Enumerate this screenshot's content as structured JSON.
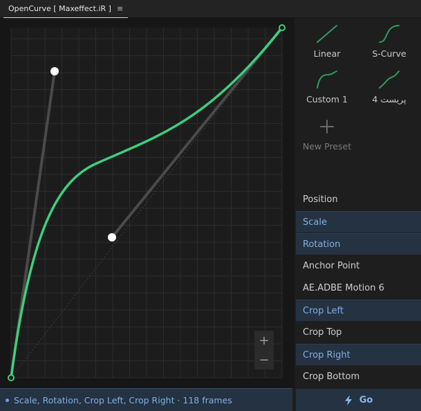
{
  "title_bar": {
    "tab_label": "OpenCurve [ Maxeffect.iR ]",
    "menu_glyph": "≡",
    "menu_icon": "hamburger-menu-icon"
  },
  "graph": {
    "grid_color": "#2c2c2c",
    "curve_color": "#3ecf7e",
    "handle_color": "#4a4a4a",
    "zoom": {
      "in_glyph": "+",
      "out_glyph": "−"
    }
  },
  "presets": [
    {
      "label": "Linear",
      "icon": "linear-curve-icon"
    },
    {
      "label": "S-Curve",
      "icon": "s-curve-icon"
    },
    {
      "label": "Custom 1",
      "icon": "custom-curve-icon"
    },
    {
      "label": "پریست 4",
      "icon": "preset-curve-icon"
    },
    {
      "label": "New Preset",
      "icon": "plus-icon"
    }
  ],
  "properties": [
    {
      "label": "Position",
      "selected": false
    },
    {
      "label": "Scale",
      "selected": true
    },
    {
      "label": "Rotation",
      "selected": true
    },
    {
      "label": "Anchor Point",
      "selected": false
    },
    {
      "label": "AE.ADBE Motion 6",
      "selected": false
    },
    {
      "label": "Crop Left",
      "selected": true
    },
    {
      "label": "Crop Top",
      "selected": false
    },
    {
      "label": "Crop Right",
      "selected": true
    },
    {
      "label": "Crop Bottom",
      "selected": false
    }
  ],
  "status": {
    "text": "Scale, Rotation, Crop Left, Crop Right · 118 frames"
  },
  "go_button": {
    "label": "Go",
    "icon": "lightning-bolt-icon"
  },
  "colors": {
    "accent": "#7fb0e6",
    "selected_bg": "#253241",
    "curve": "#3ecf7e"
  }
}
